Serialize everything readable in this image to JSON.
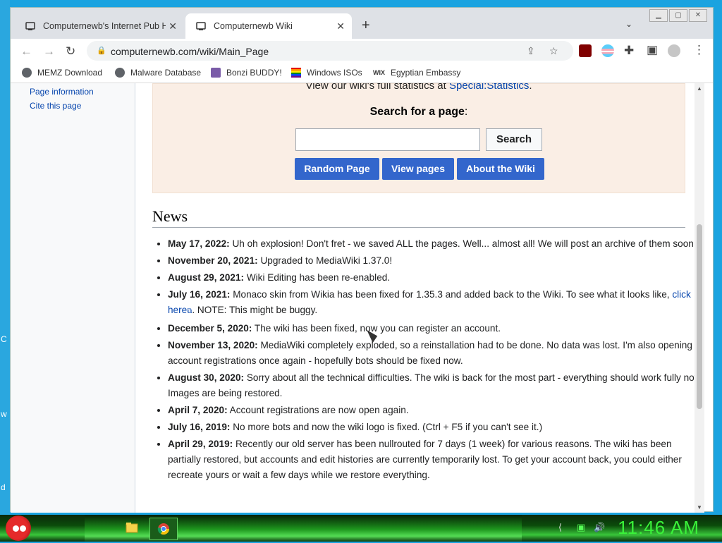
{
  "browser": {
    "tabs": [
      {
        "title": "Computernewb's Internet Pub Hub",
        "active": false
      },
      {
        "title": "Computernewb Wiki",
        "active": true
      }
    ],
    "url": "computernewb.com/wiki/Main_Page",
    "bookmarks": [
      "MEMZ Download",
      "Malware Database",
      "Bonzi BUDDY!",
      "Windows ISOs",
      "Egyptian Embassy"
    ]
  },
  "sidebar": {
    "links": [
      "Page information",
      "Cite this page"
    ]
  },
  "stats": {
    "text": "View our wiki's full statistics at ",
    "link": "Special:Statistics",
    "suffix": "."
  },
  "search": {
    "title": "Search for a page",
    "button": "Search",
    "buttons": [
      "Random Page",
      "View pages",
      "About the Wiki"
    ]
  },
  "news": {
    "heading": "News",
    "items": [
      {
        "date": "May 17, 2022:",
        "text": " Uh oh explosion! Don't fret - we saved ALL the pages. Well... almost all! We will post an archive of them soon!"
      },
      {
        "date": "November 20, 2021:",
        "text": " Upgraded to MediaWiki 1.37.0!"
      },
      {
        "date": "August 29, 2021:",
        "text": " Wiki Editing has been re-enabled."
      },
      {
        "date": "July 16, 2021:",
        "text": " Monaco skin from Wikia has been fixed for 1.35.3 and added back to the Wiki. To see what it looks like, ",
        "link": "click here",
        "after": ". NOTE: This might be buggy."
      },
      {
        "date": "December 5, 2020:",
        "text": " The wiki has been fixed, now you can register an account."
      },
      {
        "date": "November 13, 2020:",
        "text": " MediaWiki completely exploded, so a reinstallation had to be done. No data was lost. I'm also opening account registrations once again - hopefully bots should be fixed now."
      },
      {
        "date": "August 30, 2020:",
        "text": " Sorry about all the technical difficulties. The wiki is back for the most part - everything should work fully now. Images are being restored."
      },
      {
        "date": "April 7, 2020:",
        "text": " Account registrations are now open again."
      },
      {
        "date": "July 16, 2019:",
        "text": " No more bots and now the wiki logo is fixed. (Ctrl + F5 if you can't see it.)"
      },
      {
        "date": "April 29, 2019:",
        "text": " Recently our old server has been nullrouted for 7 days (1 week) for various reasons. The wiki has been partially restored, but accounts and edit histories are currently temporarily lost. To get your account back, you could either recreate yours or wait a few days while we restore everything."
      }
    ]
  },
  "taskbar": {
    "clock": "11:46 AM"
  },
  "desktop": {
    "edge_letters": [
      "C",
      "w",
      "d"
    ]
  }
}
